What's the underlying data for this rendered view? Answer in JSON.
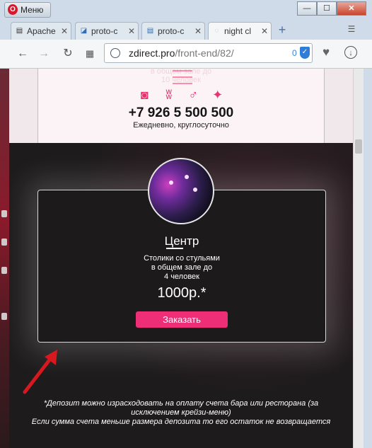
{
  "window": {
    "menu_label": "Меню",
    "opera_logo": "O",
    "minimize": "—",
    "maximize": "☐",
    "close": "✕"
  },
  "tabs": [
    {
      "label": "Apache",
      "icon": "page-icon",
      "close": "✕"
    },
    {
      "label": "proto-c",
      "icon": "proto-icon",
      "close": "✕"
    },
    {
      "label": "proto-c",
      "icon": "page-icon",
      "close": "✕"
    },
    {
      "label": "night cl",
      "icon": "page-icon",
      "close": "✕"
    }
  ],
  "new_tab": "+",
  "address": {
    "host": "zdirect.pro",
    "path": "/front-end/82/",
    "ad_count": "0"
  },
  "page": {
    "top_faded_1": "в общем зале до",
    "top_faded_2": "10 человек",
    "phone": "+7 926 5 500 500",
    "hours": "Ежедневно, круглосуточно",
    "card": {
      "title": "Центр",
      "description": [
        "Столики со стульями",
        "в общем зале до",
        "4 человек"
      ],
      "price": "1000р.*",
      "order_button": "Заказать"
    },
    "footnote_1": "*Депозит можно израсходовать на оплату счета бара или ресторана (за",
    "footnote_2": "исключением крейзи-меню)",
    "footnote_3": "Если сумма счета меньше размера депозита то его остаток не возвращается"
  },
  "colors": {
    "accent": "#ee2f78",
    "arrow": "#d8181f",
    "page_bg": "#1d1b1c"
  }
}
